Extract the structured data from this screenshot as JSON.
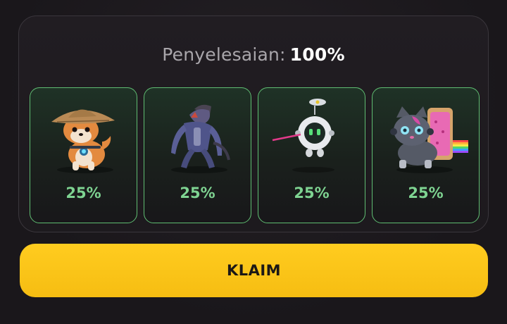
{
  "completion": {
    "label": "Penyelesaian:",
    "value": "100%"
  },
  "cards": [
    {
      "icon": "shiba-dog-hat-icon",
      "percent": "25%"
    },
    {
      "icon": "robot-monster-icon",
      "percent": "25%"
    },
    {
      "icon": "flying-robot-drone-icon",
      "percent": "25%"
    },
    {
      "icon": "robot-cat-icon",
      "percent": "25%"
    }
  ],
  "claim_button": {
    "label": "KLAIM"
  },
  "colors": {
    "accent_green": "#7ed391",
    "card_border": "#5fbd72",
    "button_yellow": "#f6bd12"
  }
}
